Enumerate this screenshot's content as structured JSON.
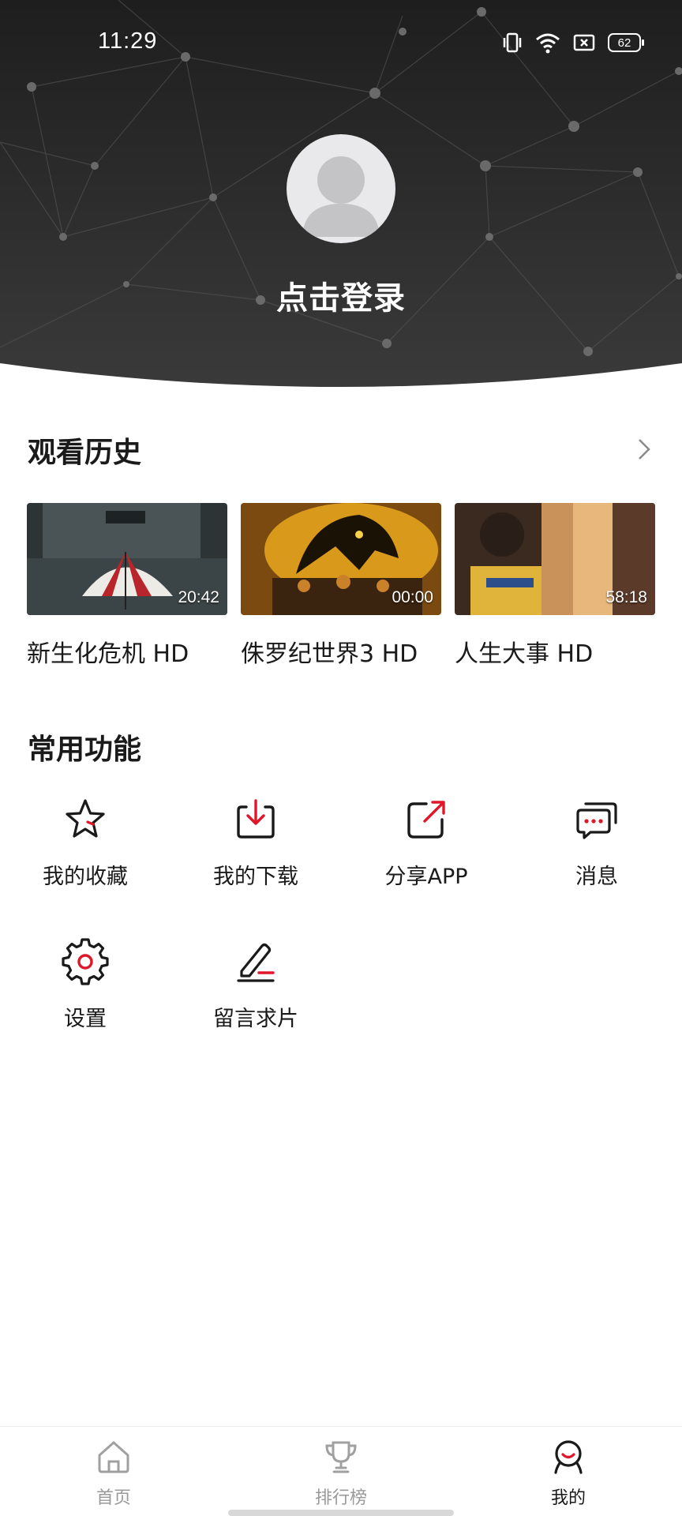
{
  "status": {
    "time": "11:29",
    "battery": "62"
  },
  "profile": {
    "login_label": "点击登录"
  },
  "history": {
    "title": "观看历史",
    "items": [
      {
        "title": "新生化危机 HD",
        "duration": "20:42"
      },
      {
        "title": "侏罗纪世界3 HD",
        "duration": "00:00"
      },
      {
        "title": "人生大事 HD",
        "duration": "58:18"
      }
    ]
  },
  "functions": {
    "title": "常用功能",
    "items": [
      {
        "label": "我的收藏",
        "icon": "star-icon"
      },
      {
        "label": "我的下载",
        "icon": "download-icon"
      },
      {
        "label": "分享APP",
        "icon": "share-icon"
      },
      {
        "label": "消息",
        "icon": "message-icon"
      },
      {
        "label": "设置",
        "icon": "gear-icon"
      },
      {
        "label": "留言求片",
        "icon": "edit-icon"
      }
    ]
  },
  "tabbar": {
    "items": [
      {
        "label": "首页",
        "icon": "home-icon"
      },
      {
        "label": "排行榜",
        "icon": "trophy-icon"
      },
      {
        "label": "我的",
        "icon": "profile-icon",
        "active": true
      }
    ]
  },
  "colors": {
    "accent": "#e0162b",
    "header_dark": "#262626",
    "text": "#1a1a1a",
    "muted": "#9a9a9a"
  }
}
